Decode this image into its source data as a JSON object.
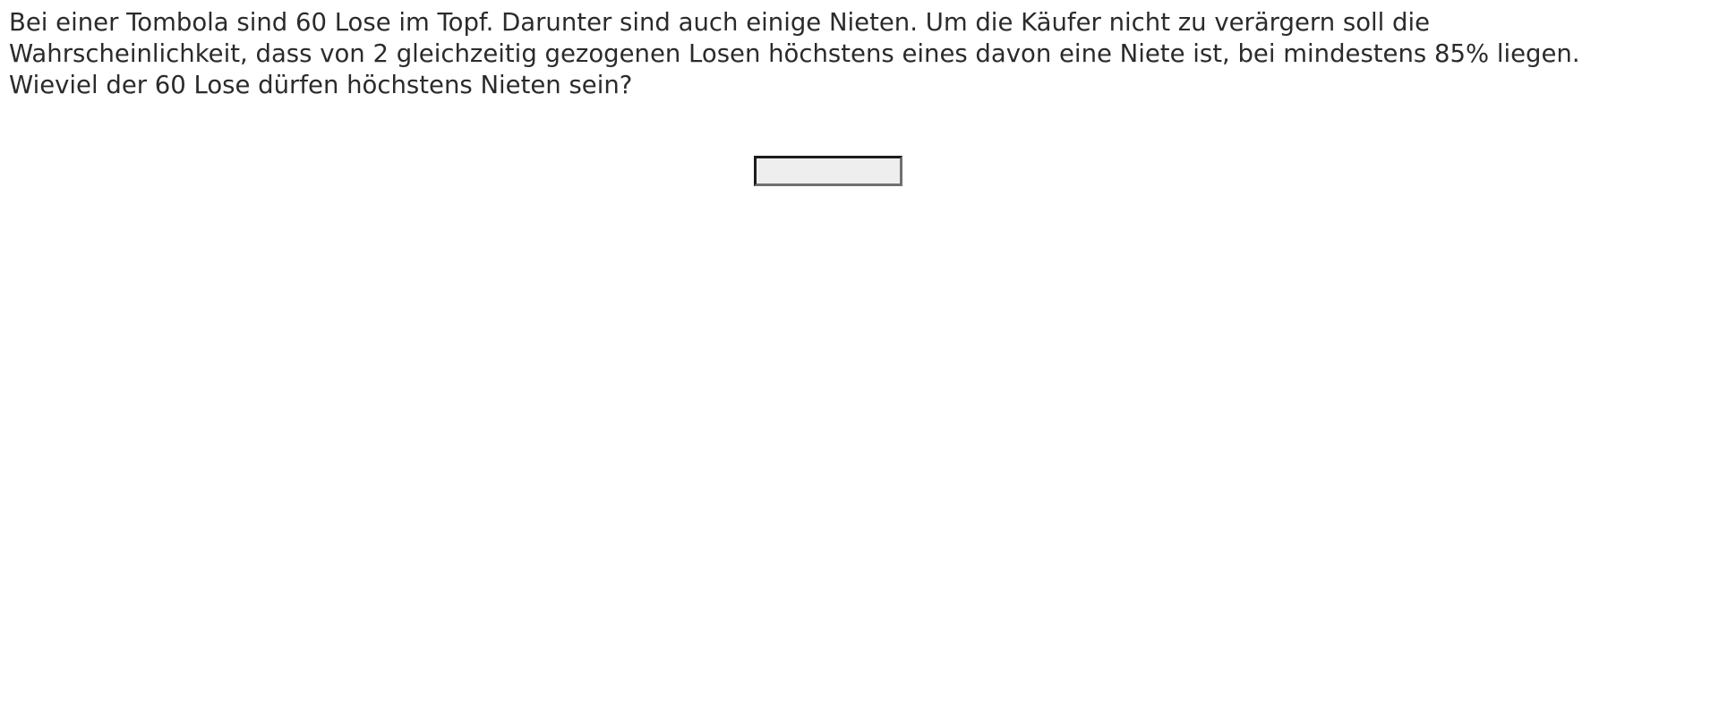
{
  "question": {
    "lines": [
      "Bei einer Tombola sind 60 Lose im Topf. Darunter sind auch einige Nieten. Um die Käufer nicht zu verärgern soll die",
      "Wahrscheinlichkeit, dass von 2 gleichzeitig gezogenen Losen höchstens eines davon eine Niete ist, bei mindestens 85% liegen.",
      "Wieviel der 60 Lose dürfen höchstens Nieten sein?"
    ]
  },
  "answer": {
    "value": ""
  }
}
